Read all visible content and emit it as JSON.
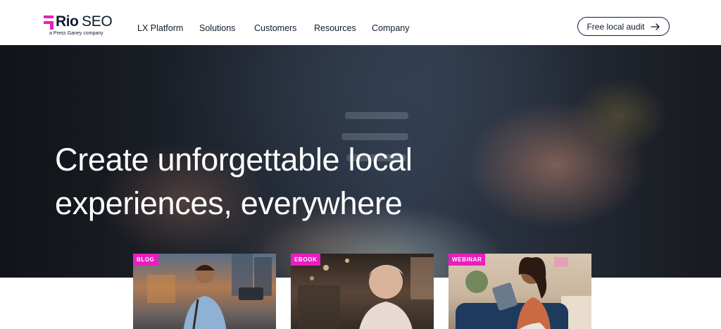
{
  "brand": {
    "name_bold": "Rio",
    "name_light": "SEO",
    "tagline": "a Press Ganey company",
    "accent_color": "#e81fbd",
    "text_color": "#0f1b2d"
  },
  "nav": {
    "items": [
      {
        "label": "LX Platform"
      },
      {
        "label": "Solutions"
      },
      {
        "label": "Customers"
      },
      {
        "label": "Resources"
      },
      {
        "label": "Company"
      }
    ],
    "cta_label": "Free local audit",
    "cta_icon": "arrow-right-icon"
  },
  "hero": {
    "title_line1": "Create unforgettable local",
    "title_line2": "experiences, everywhere"
  },
  "cards": [
    {
      "badge": "BLOG"
    },
    {
      "badge": "EBOOK"
    },
    {
      "badge": "WEBINAR"
    }
  ]
}
